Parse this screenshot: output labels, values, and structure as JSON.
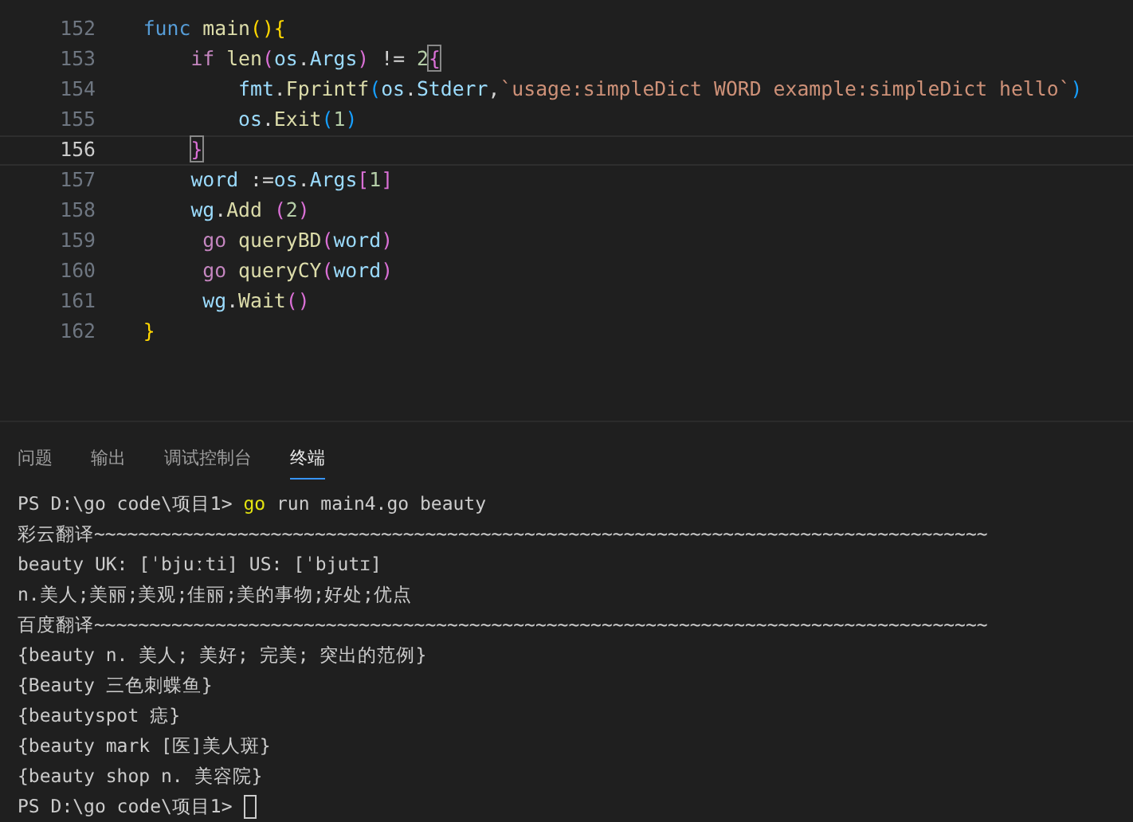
{
  "editor": {
    "lines": [
      {
        "number": "152",
        "current": false,
        "tokens": [
          {
            "text": "    func",
            "kind": "keyword"
          },
          {
            "text": " main",
            "kind": "function"
          },
          {
            "text": "(){",
            "kind": "bracket1"
          }
        ]
      },
      {
        "number": "153",
        "current": false,
        "tokens": [
          {
            "text": "        if",
            "kind": "control"
          },
          {
            "text": " len",
            "kind": "function"
          },
          {
            "text": "(",
            "kind": "bracket2"
          },
          {
            "text": "os",
            "kind": "variable"
          },
          {
            "text": ".",
            "kind": "plain"
          },
          {
            "text": "Args",
            "kind": "variable"
          },
          {
            "text": ")",
            "kind": "bracket2"
          },
          {
            "text": " != ",
            "kind": "plain"
          },
          {
            "text": "2",
            "kind": "number"
          },
          {
            "text": "{",
            "kind": "bracket2",
            "boxed": true
          }
        ]
      },
      {
        "number": "154",
        "current": false,
        "tokens": [
          {
            "text": "            fmt",
            "kind": "variable"
          },
          {
            "text": ".",
            "kind": "plain"
          },
          {
            "text": "Fprintf",
            "kind": "function"
          },
          {
            "text": "(",
            "kind": "bracket3"
          },
          {
            "text": "os",
            "kind": "variable"
          },
          {
            "text": ".",
            "kind": "plain"
          },
          {
            "text": "Stderr",
            "kind": "variable"
          },
          {
            "text": ",",
            "kind": "plain"
          },
          {
            "text": "`usage:simpleDict WORD example:simpleDict hello`",
            "kind": "string"
          },
          {
            "text": ")",
            "kind": "bracket3"
          }
        ]
      },
      {
        "number": "155",
        "current": false,
        "tokens": [
          {
            "text": "            os",
            "kind": "variable"
          },
          {
            "text": ".",
            "kind": "plain"
          },
          {
            "text": "Exit",
            "kind": "function"
          },
          {
            "text": "(",
            "kind": "bracket3"
          },
          {
            "text": "1",
            "kind": "number"
          },
          {
            "text": ")",
            "kind": "bracket3"
          }
        ]
      },
      {
        "number": "156",
        "current": true,
        "tokens": [
          {
            "text": "        }",
            "kind": "bracket2",
            "boxed": true
          }
        ]
      },
      {
        "number": "157",
        "current": false,
        "tokens": [
          {
            "text": "        word",
            "kind": "variable"
          },
          {
            "text": " :=",
            "kind": "plain"
          },
          {
            "text": "os",
            "kind": "variable"
          },
          {
            "text": ".",
            "kind": "plain"
          },
          {
            "text": "Args",
            "kind": "variable"
          },
          {
            "text": "[",
            "kind": "bracket2"
          },
          {
            "text": "1",
            "kind": "number"
          },
          {
            "text": "]",
            "kind": "bracket2"
          }
        ]
      },
      {
        "number": "158",
        "current": false,
        "tokens": [
          {
            "text": "        wg",
            "kind": "variable"
          },
          {
            "text": ".",
            "kind": "plain"
          },
          {
            "text": "Add",
            "kind": "function"
          },
          {
            "text": " (",
            "kind": "bracket2"
          },
          {
            "text": "2",
            "kind": "number"
          },
          {
            "text": ")",
            "kind": "bracket2"
          }
        ]
      },
      {
        "number": "159",
        "current": false,
        "tokens": [
          {
            "text": "         go",
            "kind": "control"
          },
          {
            "text": " queryBD",
            "kind": "function"
          },
          {
            "text": "(",
            "kind": "bracket2"
          },
          {
            "text": "word",
            "kind": "variable"
          },
          {
            "text": ")",
            "kind": "bracket2"
          }
        ]
      },
      {
        "number": "160",
        "current": false,
        "tokens": [
          {
            "text": "         go",
            "kind": "control"
          },
          {
            "text": " queryCY",
            "kind": "function"
          },
          {
            "text": "(",
            "kind": "bracket2"
          },
          {
            "text": "word",
            "kind": "variable"
          },
          {
            "text": ")",
            "kind": "bracket2"
          }
        ]
      },
      {
        "number": "161",
        "current": false,
        "tokens": [
          {
            "text": "         wg",
            "kind": "variable"
          },
          {
            "text": ".",
            "kind": "plain"
          },
          {
            "text": "Wait",
            "kind": "function"
          },
          {
            "text": "()",
            "kind": "bracket2"
          }
        ]
      },
      {
        "number": "162",
        "current": false,
        "tokens": [
          {
            "text": "    }",
            "kind": "bracket1"
          }
        ]
      }
    ]
  },
  "panel": {
    "tabs": [
      {
        "label": "问题",
        "selected": false
      },
      {
        "label": "输出",
        "selected": false
      },
      {
        "label": "调试控制台",
        "selected": false
      },
      {
        "label": "终端",
        "selected": true
      }
    ],
    "terminal": {
      "lines": [
        {
          "tokens": [
            {
              "text": "PS D:\\go code\\项目1>",
              "kind": "plain"
            },
            {
              "text": " go",
              "kind": "command"
            },
            {
              "text": " run main4.go beauty",
              "kind": "plain"
            }
          ]
        },
        {
          "tokens": [
            {
              "text": "彩云翻译~~~~~~~~~~~~~~~~~~~~~~~~~~~~~~~~~~~~~~~~~~~~~~~~~~~~~~~~~~~~~~~~~~~~~~~~~~~~~~~~~",
              "kind": "plain"
            }
          ]
        },
        {
          "tokens": [
            {
              "text": "beauty UK: [ˈbjuːti] US: [ˈbjutɪ]",
              "kind": "plain"
            }
          ]
        },
        {
          "tokens": [
            {
              "text": "n.美人;美丽;美观;佳丽;美的事物;好处;优点",
              "kind": "plain"
            }
          ]
        },
        {
          "tokens": [
            {
              "text": "百度翻译~~~~~~~~~~~~~~~~~~~~~~~~~~~~~~~~~~~~~~~~~~~~~~~~~~~~~~~~~~~~~~~~~~~~~~~~~~~~~~~~~",
              "kind": "plain"
            }
          ]
        },
        {
          "tokens": [
            {
              "text": "{beauty n. 美人; 美好; 完美; 突出的范例}",
              "kind": "plain"
            }
          ]
        },
        {
          "tokens": [
            {
              "text": "{Beauty 三色刺蝶鱼}",
              "kind": "plain"
            }
          ]
        },
        {
          "tokens": [
            {
              "text": "{beautyspot 痣}",
              "kind": "plain"
            }
          ]
        },
        {
          "tokens": [
            {
              "text": "{beauty mark [医]美人斑}",
              "kind": "plain"
            }
          ]
        },
        {
          "tokens": [
            {
              "text": "{beauty shop n. 美容院}",
              "kind": "plain"
            }
          ]
        },
        {
          "tokens": [
            {
              "text": "PS D:\\go code\\项目1>",
              "kind": "plain"
            }
          ],
          "cursor": true
        }
      ]
    }
  }
}
